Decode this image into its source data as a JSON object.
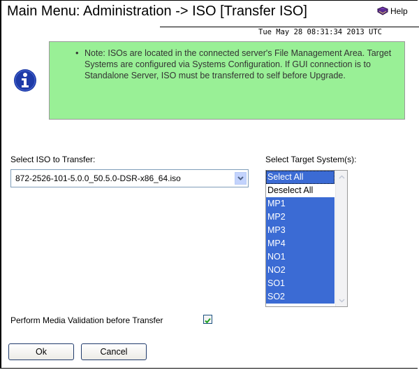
{
  "header": {
    "title": "Main Menu: Administration -> ISO [Transfer ISO]",
    "help_label": "Help",
    "timestamp": "Tue May 28 08:31:34 2013 UTC"
  },
  "note": {
    "text": "Note: ISOs are located in the connected server's File Management Area. Target Systems are configured via Systems Configuration. If GUI connection is to Standalone Server, ISO must be transferred to self before Upgrade."
  },
  "iso_select": {
    "label": "Select ISO to Transfer:",
    "value": "872-2526-101-5.0.0_50.5.0-DSR-x86_64.iso"
  },
  "target_select": {
    "label": "Select Target System(s):",
    "options": [
      {
        "label": "Select All",
        "selected": true
      },
      {
        "label": "Deselect All",
        "selected": false
      },
      {
        "label": "MP1",
        "selected": true
      },
      {
        "label": "MP2",
        "selected": true
      },
      {
        "label": "MP3",
        "selected": true
      },
      {
        "label": "MP4",
        "selected": true
      },
      {
        "label": "NO1",
        "selected": true
      },
      {
        "label": "NO2",
        "selected": true
      },
      {
        "label": "SO1",
        "selected": true
      },
      {
        "label": "SO2",
        "selected": true
      }
    ]
  },
  "media_validation": {
    "label": "Perform Media Validation before Transfer",
    "checked": true
  },
  "buttons": {
    "ok": "Ok",
    "cancel": "Cancel"
  },
  "colors": {
    "note_background": "#99f096",
    "selection": "#3b6bd4",
    "info_icon": "#1e3ba8"
  }
}
